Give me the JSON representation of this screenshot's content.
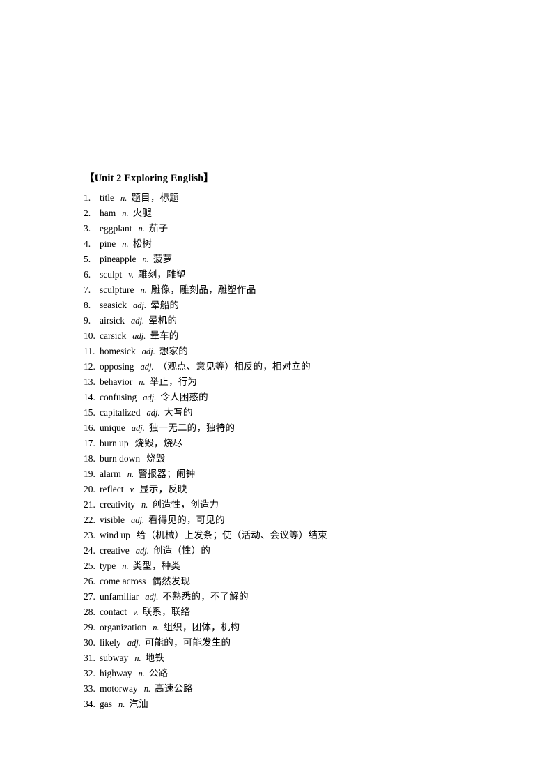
{
  "document": {
    "unit_title": "【Unit 2 Exploring English】",
    "entries": [
      {
        "num": "1.",
        "word": "title",
        "pos": "n.",
        "cn": "题目，标题"
      },
      {
        "num": "2.",
        "word": "ham",
        "pos": "n.",
        "cn": "火腿"
      },
      {
        "num": "3.",
        "word": "eggplant",
        "pos": "n.",
        "cn": "茄子"
      },
      {
        "num": "4.",
        "word": "pine",
        "pos": "n.",
        "cn": "松树"
      },
      {
        "num": "5.",
        "word": "pineapple",
        "pos": "n.",
        "cn": "菠萝"
      },
      {
        "num": "6.",
        "word": "sculpt",
        "pos": "v.",
        "cn": "雕刻，雕塑"
      },
      {
        "num": "7.",
        "word": "sculpture",
        "pos": "n.",
        "cn": "雕像，雕刻品，雕塑作品"
      },
      {
        "num": "8.",
        "word": "seasick",
        "pos": "adj.",
        "cn": "晕船的"
      },
      {
        "num": "9.",
        "word": "airsick",
        "pos": "adj.",
        "cn": "晕机的"
      },
      {
        "num": "10.",
        "word": "carsick",
        "pos": "adj.",
        "cn": "晕车的"
      },
      {
        "num": "11.",
        "word": "homesick",
        "pos": "adj.",
        "cn": "想家的"
      },
      {
        "num": "12.",
        "word": "opposing",
        "pos": "adj.",
        "cn": "（观点、意见等）相反的，相对立的"
      },
      {
        "num": "13.",
        "word": "behavior",
        "pos": "n.",
        "cn": "举止，行为"
      },
      {
        "num": "14.",
        "word": "confusing",
        "pos": "adj.",
        "cn": "令人困惑的"
      },
      {
        "num": "15.",
        "word": "capitalized",
        "pos": "adj.",
        "cn": "大写的"
      },
      {
        "num": "16.",
        "word": "unique",
        "pos": "adj.",
        "cn": "独一无二的，独特的"
      },
      {
        "num": "17.",
        "word": "burn up",
        "pos": "",
        "cn": "烧毁，烧尽"
      },
      {
        "num": "18.",
        "word": "burn down",
        "pos": "",
        "cn": "烧毁"
      },
      {
        "num": "19.",
        "word": "alarm",
        "pos": "n.",
        "cn": "警报器；闹钟"
      },
      {
        "num": "20.",
        "word": "reflect",
        "pos": "v.",
        "cn": "显示，反映"
      },
      {
        "num": "21.",
        "word": "creativity",
        "pos": "n.",
        "cn": "创造性，创造力"
      },
      {
        "num": "22.",
        "word": "visible",
        "pos": "adj.",
        "cn": "看得见的，可见的"
      },
      {
        "num": "23.",
        "word": "wind up",
        "pos": "",
        "cn": "给（机械）上发条；使（活动、会议等）结束"
      },
      {
        "num": "24.",
        "word": "creative",
        "pos": "adj.",
        "cn": "创造（性）的"
      },
      {
        "num": "25.",
        "word": "type",
        "pos": "n.",
        "cn": "类型，种类"
      },
      {
        "num": "26.",
        "word": "come across",
        "pos": "",
        "cn": "偶然发现"
      },
      {
        "num": "27.",
        "word": "unfamiliar",
        "pos": "adj.",
        "cn": "不熟悉的，不了解的"
      },
      {
        "num": "28.",
        "word": "contact",
        "pos": "v.",
        "cn": "联系，联络"
      },
      {
        "num": "29.",
        "word": "organization",
        "pos": "n.",
        "cn": "组织，团体，机构"
      },
      {
        "num": "30.",
        "word": "likely",
        "pos": "adj.",
        "cn": "可能的，可能发生的"
      },
      {
        "num": "31.",
        "word": "subway",
        "pos": "n.",
        "cn": "地铁"
      },
      {
        "num": "32.",
        "word": "highway",
        "pos": "n.",
        "cn": "公路"
      },
      {
        "num": "33.",
        "word": "motorway",
        "pos": "n.",
        "cn": "高速公路"
      },
      {
        "num": "34.",
        "word": "gas",
        "pos": "n.",
        "cn": "汽油"
      }
    ]
  }
}
